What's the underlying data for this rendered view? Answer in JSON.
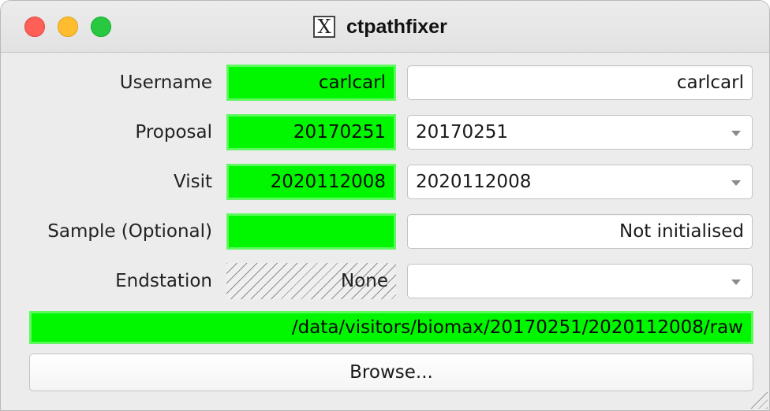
{
  "window": {
    "title": "ctpathfixer",
    "app_icon": "x11-icon"
  },
  "form": {
    "username": {
      "label": "Username",
      "resolved": "carlcarl",
      "input_value": "carlcarl"
    },
    "proposal": {
      "label": "Proposal",
      "resolved": "20170251",
      "selected": "20170251"
    },
    "visit": {
      "label": "Visit",
      "resolved": "2020112008",
      "selected": "2020112008"
    },
    "sample": {
      "label": "Sample (Optional)",
      "resolved": "",
      "input_value": "Not initialised"
    },
    "endstation": {
      "label": "Endstation",
      "resolved": "None",
      "selected": ""
    }
  },
  "path": {
    "value": "/data/visitors/biomax/20170251/2020112008/raw"
  },
  "browse": {
    "label": "Browse..."
  },
  "colors": {
    "valid_green": "#00f700",
    "close": "#fe5f57",
    "minimize": "#febc2e",
    "maximize": "#28c840"
  }
}
